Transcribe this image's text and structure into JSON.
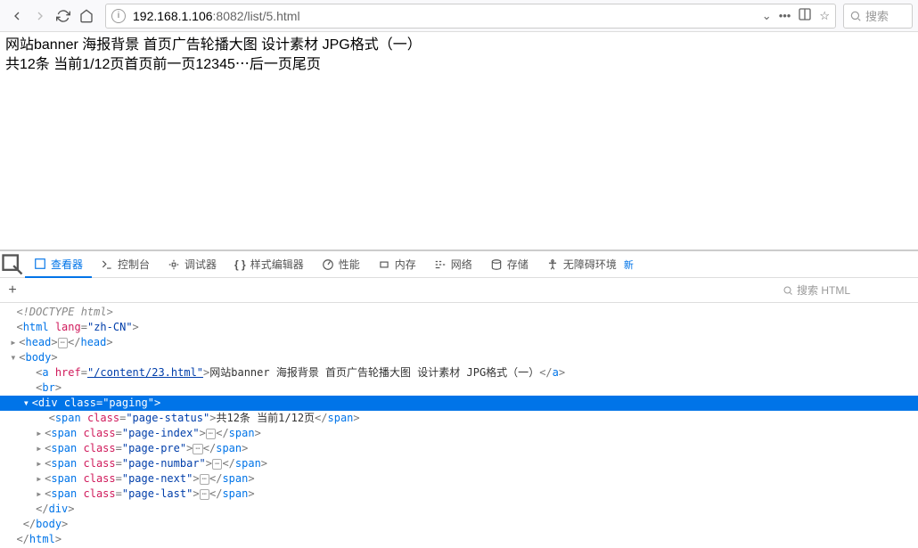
{
  "toolbar": {
    "url_prefix": "192.168.1.106",
    "url_suffix": ":8082/list/5.html",
    "search_placeholder": "搜索"
  },
  "content": {
    "link_text": "网站banner 海报背景 首页广告轮播大图 设计素材 JPG格式（一）",
    "paging_text": "共12条 当前1/12页首页前一页12345⋯后一页尾页"
  },
  "devtools": {
    "tabs": {
      "inspector": "查看器",
      "console": "控制台",
      "debugger": "调试器",
      "style": "样式编辑器",
      "perf": "性能",
      "memory": "内存",
      "network": "网络",
      "storage": "存储",
      "a11y": "无障碍环境",
      "new_badge": "新"
    },
    "search_placeholder": "搜索 HTML",
    "html": {
      "doctype": "<!DOCTYPE html>",
      "html_open": "html",
      "lang_attr": "lang",
      "lang_val": "\"zh-CN\"",
      "head": "head",
      "body": "body",
      "a_tag": "a",
      "href_attr": "href",
      "href_val": "\"/content/23.html\"",
      "a_text": "网站banner 海报背景 首页广告轮播大图 设计素材 JPG格式（一）",
      "br": "br",
      "div": "div",
      "class_attr": "class",
      "paging_val": "\"paging\"",
      "span": "span",
      "status_val": "\"page-status\"",
      "status_text": "共12条 当前1/12页",
      "index_val": "\"page-index\"",
      "pre_val": "\"page-pre\"",
      "numbar_val": "\"page-numbar\"",
      "next_val": "\"page-next\"",
      "last_val": "\"page-last\""
    }
  }
}
